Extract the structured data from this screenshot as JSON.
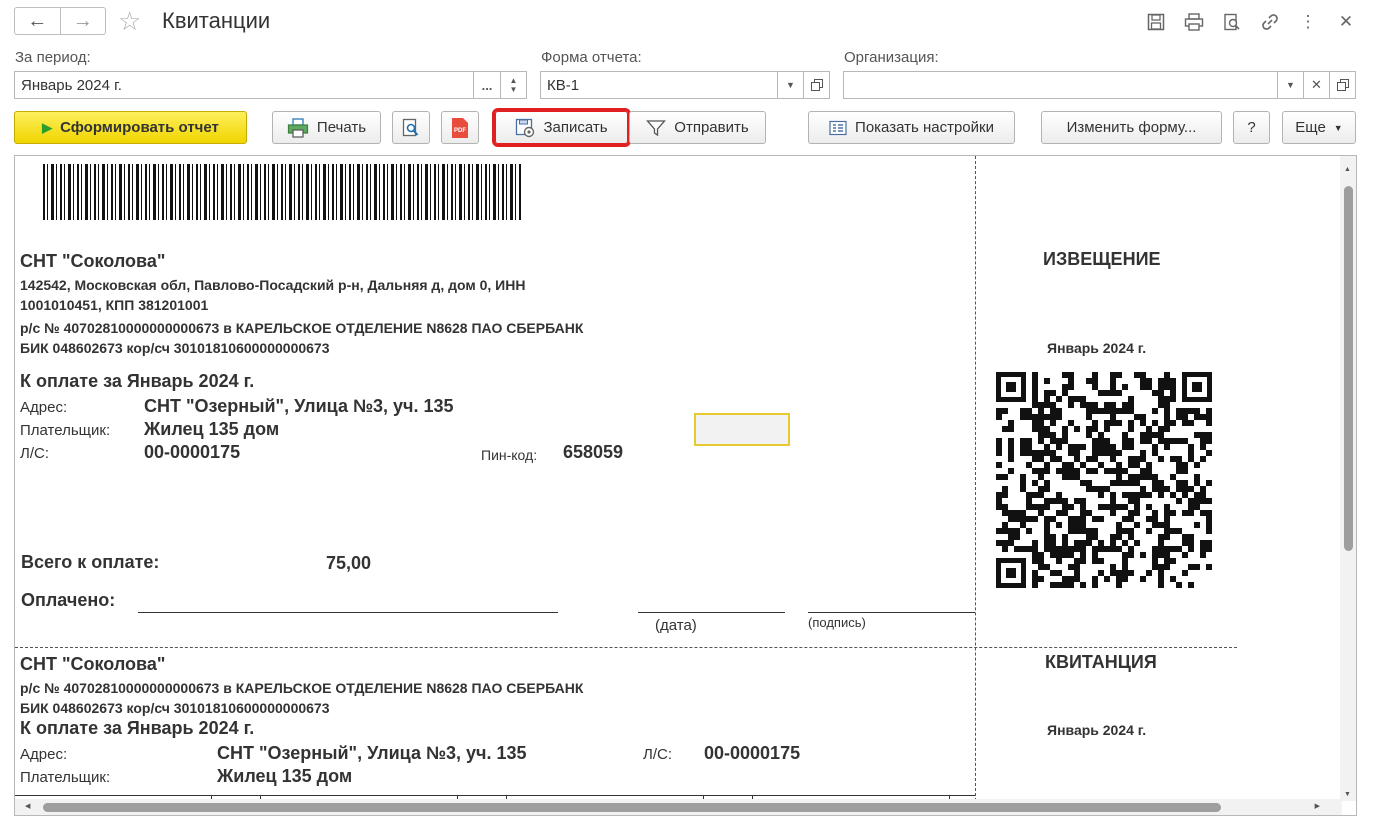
{
  "window": {
    "title": "Квитанции"
  },
  "filters": {
    "period_label": "За период:",
    "period_value": "Январь 2024 г.",
    "period_select": "...",
    "form_label": "Форма отчета:",
    "form_value": "КВ-1",
    "org_label": "Организация:",
    "org_value": ""
  },
  "toolbar": {
    "generate": "Сформировать отчет",
    "print": "Печать",
    "save": "Записать",
    "send": "Отправить",
    "settings": "Показать настройки",
    "change_form": "Изменить форму...",
    "help": "?",
    "more": "Еще"
  },
  "receipt": {
    "org_name": "СНТ \"Соколова\"",
    "org_address_1": "142542, Московская обл, Павлово-Посадский р-н, Дальняя д, дом 0, ИНН",
    "org_address_2": "1001010451, КПП 381201001",
    "bank_1": "р/с № 40702810000000000673 в КАРЕЛЬСКОЕ ОТДЕЛЕНИЕ N8628 ПАО СБЕРБАНК",
    "bank_2": "БИК 048602673 кор/сч 30101810600000000673",
    "pay_for": "К оплате за Январь 2024 г.",
    "address_label": "Адрес:",
    "address_value": "СНТ \"Озерный\", Улица №3, уч. 135",
    "payer_label": "Плательщик:",
    "payer_value": "Жилец 135 дом",
    "account_label": "Л/С:",
    "account_value": "00-0000175",
    "pin_label": "Пин-код:",
    "pin_value": "658059",
    "total_label": "Всего к оплате:",
    "total_value": "75,00",
    "paid_label": "Оплачено:",
    "date_caption": "(дата)",
    "signature_caption": "(подпись)",
    "notice_title": "ИЗВЕЩЕНИЕ",
    "notice_period": "Январь 2024 г.",
    "receipt_title": "КВИТАНЦИЯ",
    "receipt_period": "Январь 2024 г."
  },
  "colors": {
    "primary_button": "#f0d400",
    "highlight": "#e02020",
    "selection_cell": "#e8c930"
  }
}
